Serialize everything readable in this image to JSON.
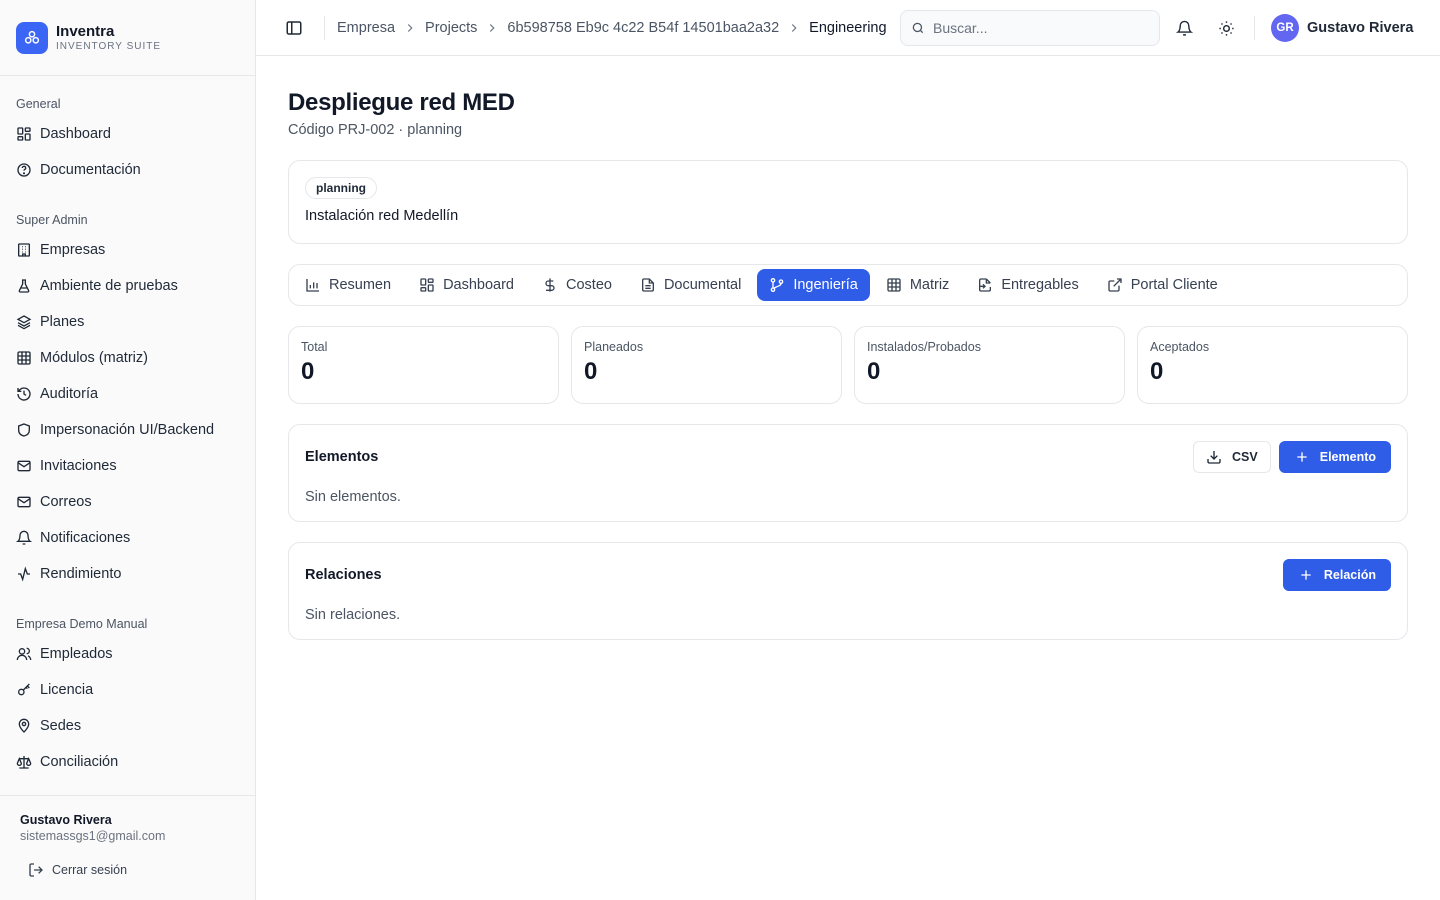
{
  "brand": {
    "name": "Inventra",
    "subtitle": "INVENTORY SUITE"
  },
  "sidebar": {
    "sections": [
      {
        "label": "General",
        "items": [
          {
            "label": "Dashboard",
            "icon": "grid-icon"
          },
          {
            "label": "Documentación",
            "icon": "help-circle-icon"
          }
        ]
      },
      {
        "label": "Super Admin",
        "items": [
          {
            "label": "Empresas",
            "icon": "building-icon"
          },
          {
            "label": "Ambiente de pruebas",
            "icon": "flask-icon"
          },
          {
            "label": "Planes",
            "icon": "layers-icon"
          },
          {
            "label": "Módulos (matriz)",
            "icon": "table-icon"
          },
          {
            "label": "Auditoría",
            "icon": "history-icon"
          },
          {
            "label": "Impersonación UI/Backend",
            "icon": "shield-icon"
          },
          {
            "label": "Invitaciones",
            "icon": "mail-icon"
          },
          {
            "label": "Correos",
            "icon": "mail-icon"
          },
          {
            "label": "Notificaciones",
            "icon": "bell-icon"
          },
          {
            "label": "Rendimiento",
            "icon": "activity-icon"
          }
        ]
      },
      {
        "label": "Empresa Demo Manual",
        "items": [
          {
            "label": "Empleados",
            "icon": "users-icon"
          },
          {
            "label": "Licencia",
            "icon": "key-icon"
          },
          {
            "label": "Sedes",
            "icon": "map-pin-icon"
          },
          {
            "label": "Conciliación",
            "icon": "scale-icon"
          }
        ]
      }
    ],
    "footer": {
      "name": "Gustavo Rivera",
      "email": "sistemassgs1@gmail.com",
      "logout": "Cerrar sesión"
    }
  },
  "topbar": {
    "breadcrumbs": [
      "Empresa",
      "Projects",
      "6b598758 Eb9c 4c22 B54f 14501baa2a32",
      "Engineering"
    ],
    "search_placeholder": "Buscar...",
    "user": {
      "initials": "GR",
      "name": "Gustavo Rivera"
    }
  },
  "page": {
    "title": "Despliegue red MED",
    "subtitle": "Código PRJ-002 · planning",
    "status_badge": "planning",
    "description": "Instalación red Medellín"
  },
  "tabs": [
    {
      "label": "Resumen",
      "icon": "bar-chart-icon",
      "active": false
    },
    {
      "label": "Dashboard",
      "icon": "grid-icon",
      "active": false
    },
    {
      "label": "Costeo",
      "icon": "dollar-icon",
      "active": false
    },
    {
      "label": "Documental",
      "icon": "file-text-icon",
      "active": false
    },
    {
      "label": "Ingeniería",
      "icon": "git-branch-icon",
      "active": true
    },
    {
      "label": "Matriz",
      "icon": "table-icon",
      "active": false
    },
    {
      "label": "Entregables",
      "icon": "file-export-icon",
      "active": false
    },
    {
      "label": "Portal Cliente",
      "icon": "external-link-icon",
      "active": false
    }
  ],
  "stats": [
    {
      "label": "Total",
      "value": "0"
    },
    {
      "label": "Planeados",
      "value": "0"
    },
    {
      "label": "Instalados/Probados",
      "value": "0"
    },
    {
      "label": "Aceptados",
      "value": "0"
    }
  ],
  "elements": {
    "title": "Elementos",
    "empty": "Sin elementos.",
    "csv_label": "CSV",
    "add_label": "Elemento"
  },
  "relations": {
    "title": "Relaciones",
    "empty": "Sin relaciones.",
    "add_label": "Relación"
  },
  "colors": {
    "accent": "#2f5de8",
    "avatar": "#6366f1"
  }
}
